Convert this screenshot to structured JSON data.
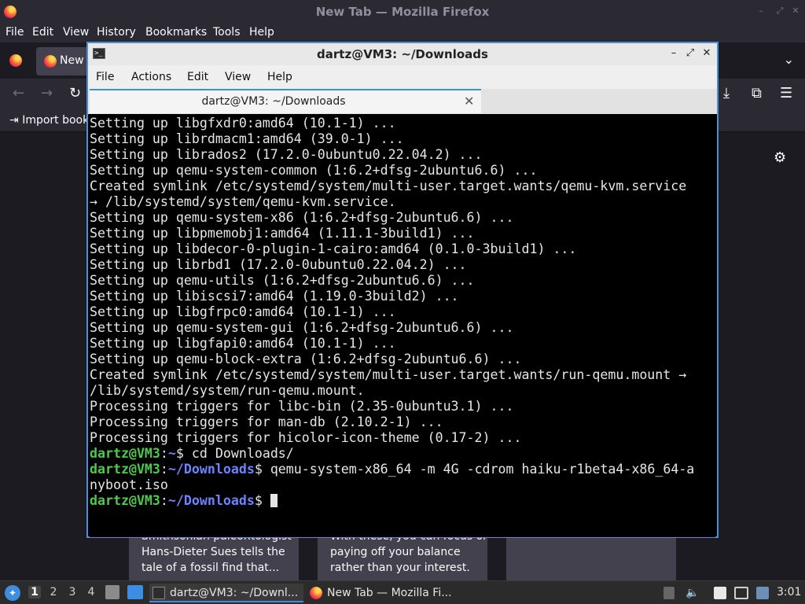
{
  "firefox": {
    "title": "New Tab — Mozilla Firefox",
    "menu": [
      "File",
      "Edit",
      "View",
      "History",
      "Bookmarks",
      "Tools",
      "Help"
    ],
    "tab_label": "New",
    "import_bookmarks": "Import book",
    "cards": [
      {
        "lines": [
          "Smithsonian paleontologist",
          "Hans-Dieter Sues tells the",
          "tale of a fossil find that..."
        ]
      },
      {
        "lines": [
          "With these, you can focus on",
          "paying off your balance",
          "rather than your interest."
        ]
      },
      {
        "lines": []
      }
    ]
  },
  "terminal": {
    "title": "dartz@VM3: ~/Downloads",
    "menu": [
      "File",
      "Actions",
      "Edit",
      "View",
      "Help"
    ],
    "tab_label": "dartz@VM3: ~/Downloads",
    "output_lines": [
      "Setting up libgfxdr0:amd64 (10.1-1) ...",
      "Setting up librdmacm1:amd64 (39.0-1) ...",
      "Setting up librados2 (17.2.0-0ubuntu0.22.04.2) ...",
      "Setting up qemu-system-common (1:6.2+dfsg-2ubuntu6.6) ...",
      "Created symlink /etc/systemd/system/multi-user.target.wants/qemu-kvm.service",
      "→ /lib/systemd/system/qemu-kvm.service.",
      "Setting up qemu-system-x86 (1:6.2+dfsg-2ubuntu6.6) ...",
      "Setting up libpmemobj1:amd64 (1.11.1-3build1) ...",
      "Setting up libdecor-0-plugin-1-cairo:amd64 (0.1.0-3build1) ...",
      "Setting up librbd1 (17.2.0-0ubuntu0.22.04.2) ...",
      "Setting up qemu-utils (1:6.2+dfsg-2ubuntu6.6) ...",
      "Setting up libiscsi7:amd64 (1.19.0-3build2) ...",
      "Setting up libgfrpc0:amd64 (10.1-1) ...",
      "Setting up qemu-system-gui (1:6.2+dfsg-2ubuntu6.6) ...",
      "Setting up libgfapi0:amd64 (10.1-1) ...",
      "Setting up qemu-block-extra (1:6.2+dfsg-2ubuntu6.6) ...",
      "Created symlink /etc/systemd/system/multi-user.target.wants/run-qemu.mount →",
      "/lib/systemd/system/run-qemu.mount.",
      "Processing triggers for libc-bin (2.35-0ubuntu3.1) ...",
      "Processing triggers for man-db (2.10.2-1) ...",
      "Processing triggers for hicolor-icon-theme (0.17-2) ..."
    ],
    "prompt_user": "dartz@VM3",
    "prompt_colon": ":",
    "prompt_lines": [
      {
        "path": "~",
        "symbol": "$",
        "command": " cd Downloads/"
      },
      {
        "path": "~/Downloads",
        "symbol": "$",
        "command": " qemu-system-x86_64 -m 4G -cdrom haiku-r1beta4-x86_64-a"
      },
      {
        "path": "~/Downloads",
        "symbol": "$",
        "command": " "
      }
    ],
    "wrapped_line": "nyboot.iso"
  },
  "taskbar": {
    "workspaces": [
      "1",
      "2",
      "3",
      "4"
    ],
    "apps": [
      {
        "label": "dartz@VM3: ~/Downl..."
      },
      {
        "label": "New Tab — Mozilla Fi..."
      }
    ],
    "clock": "3:01"
  }
}
